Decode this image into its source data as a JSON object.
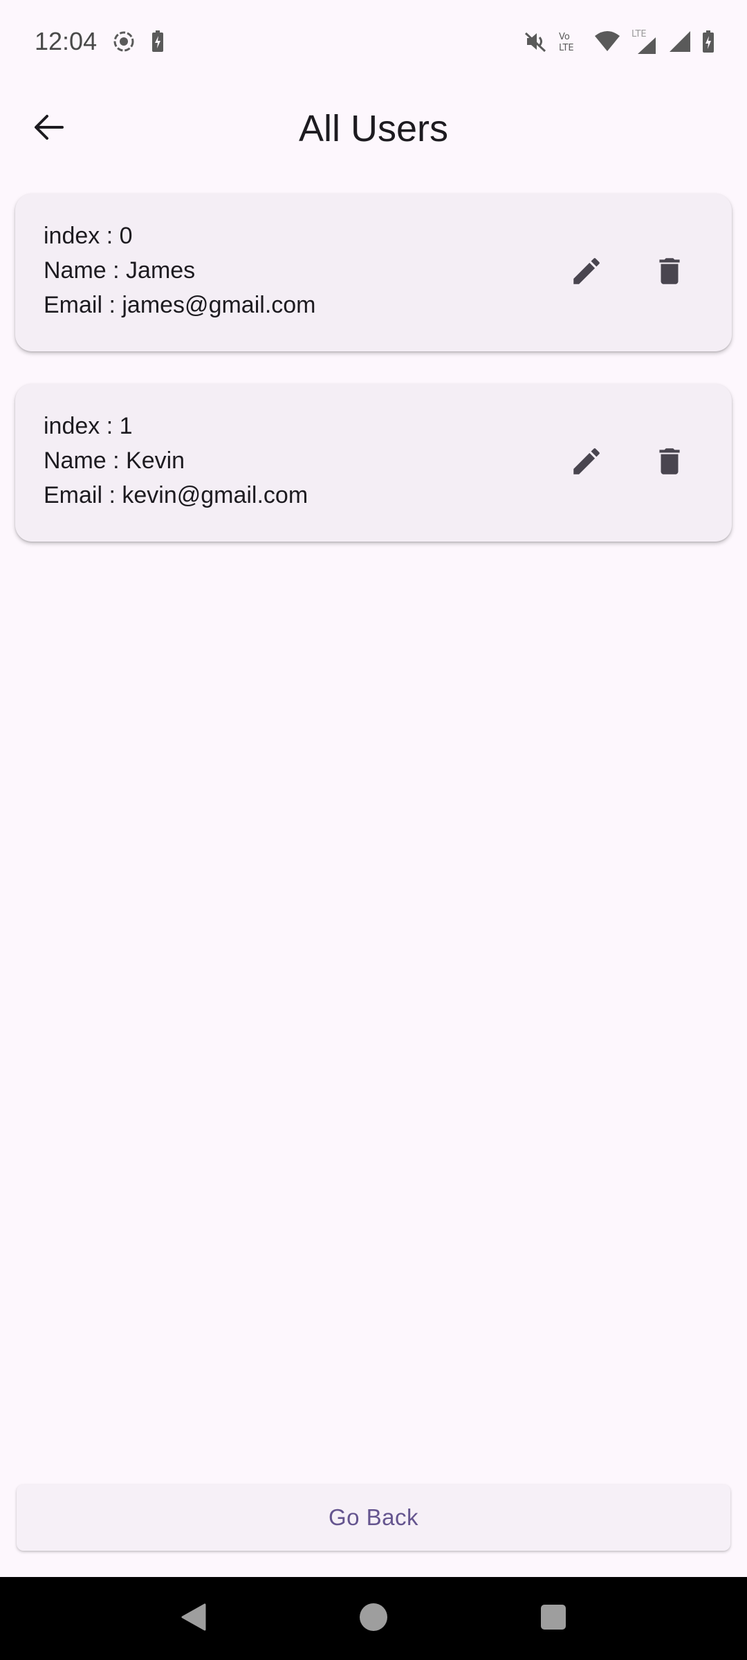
{
  "status_bar": {
    "time": "12:04",
    "left_icons": [
      "screen-record-icon",
      "battery-saver-icon"
    ],
    "right_icons": [
      "mute-icon",
      "volte-icon",
      "wifi-icon",
      "lte-signal-icon",
      "signal-icon",
      "signal-icon",
      "battery-charging-icon"
    ],
    "volte_label": "Vo LTE",
    "lte_label": "LTE"
  },
  "app_bar": {
    "back_icon": "arrow-back-icon",
    "title": "All Users"
  },
  "users": [
    {
      "index_text": "index : 0",
      "name_text": "Name : James",
      "email_text": "Email : james@gmail.com"
    },
    {
      "index_text": "index : 1",
      "name_text": "Name : Kevin",
      "email_text": "Email : kevin@gmail.com"
    }
  ],
  "actions": {
    "edit_icon": "pencil-icon",
    "delete_icon": "trash-icon"
  },
  "footer": {
    "go_back_label": "Go Back"
  },
  "nav_bar": {
    "back_icon": "nav-back-icon",
    "home_icon": "nav-home-icon",
    "recents_icon": "nav-recents-icon"
  },
  "colors": {
    "background": "#fdf7fd",
    "card": "#f4eef5",
    "icon": "#49454f",
    "button_text": "#65558f"
  }
}
